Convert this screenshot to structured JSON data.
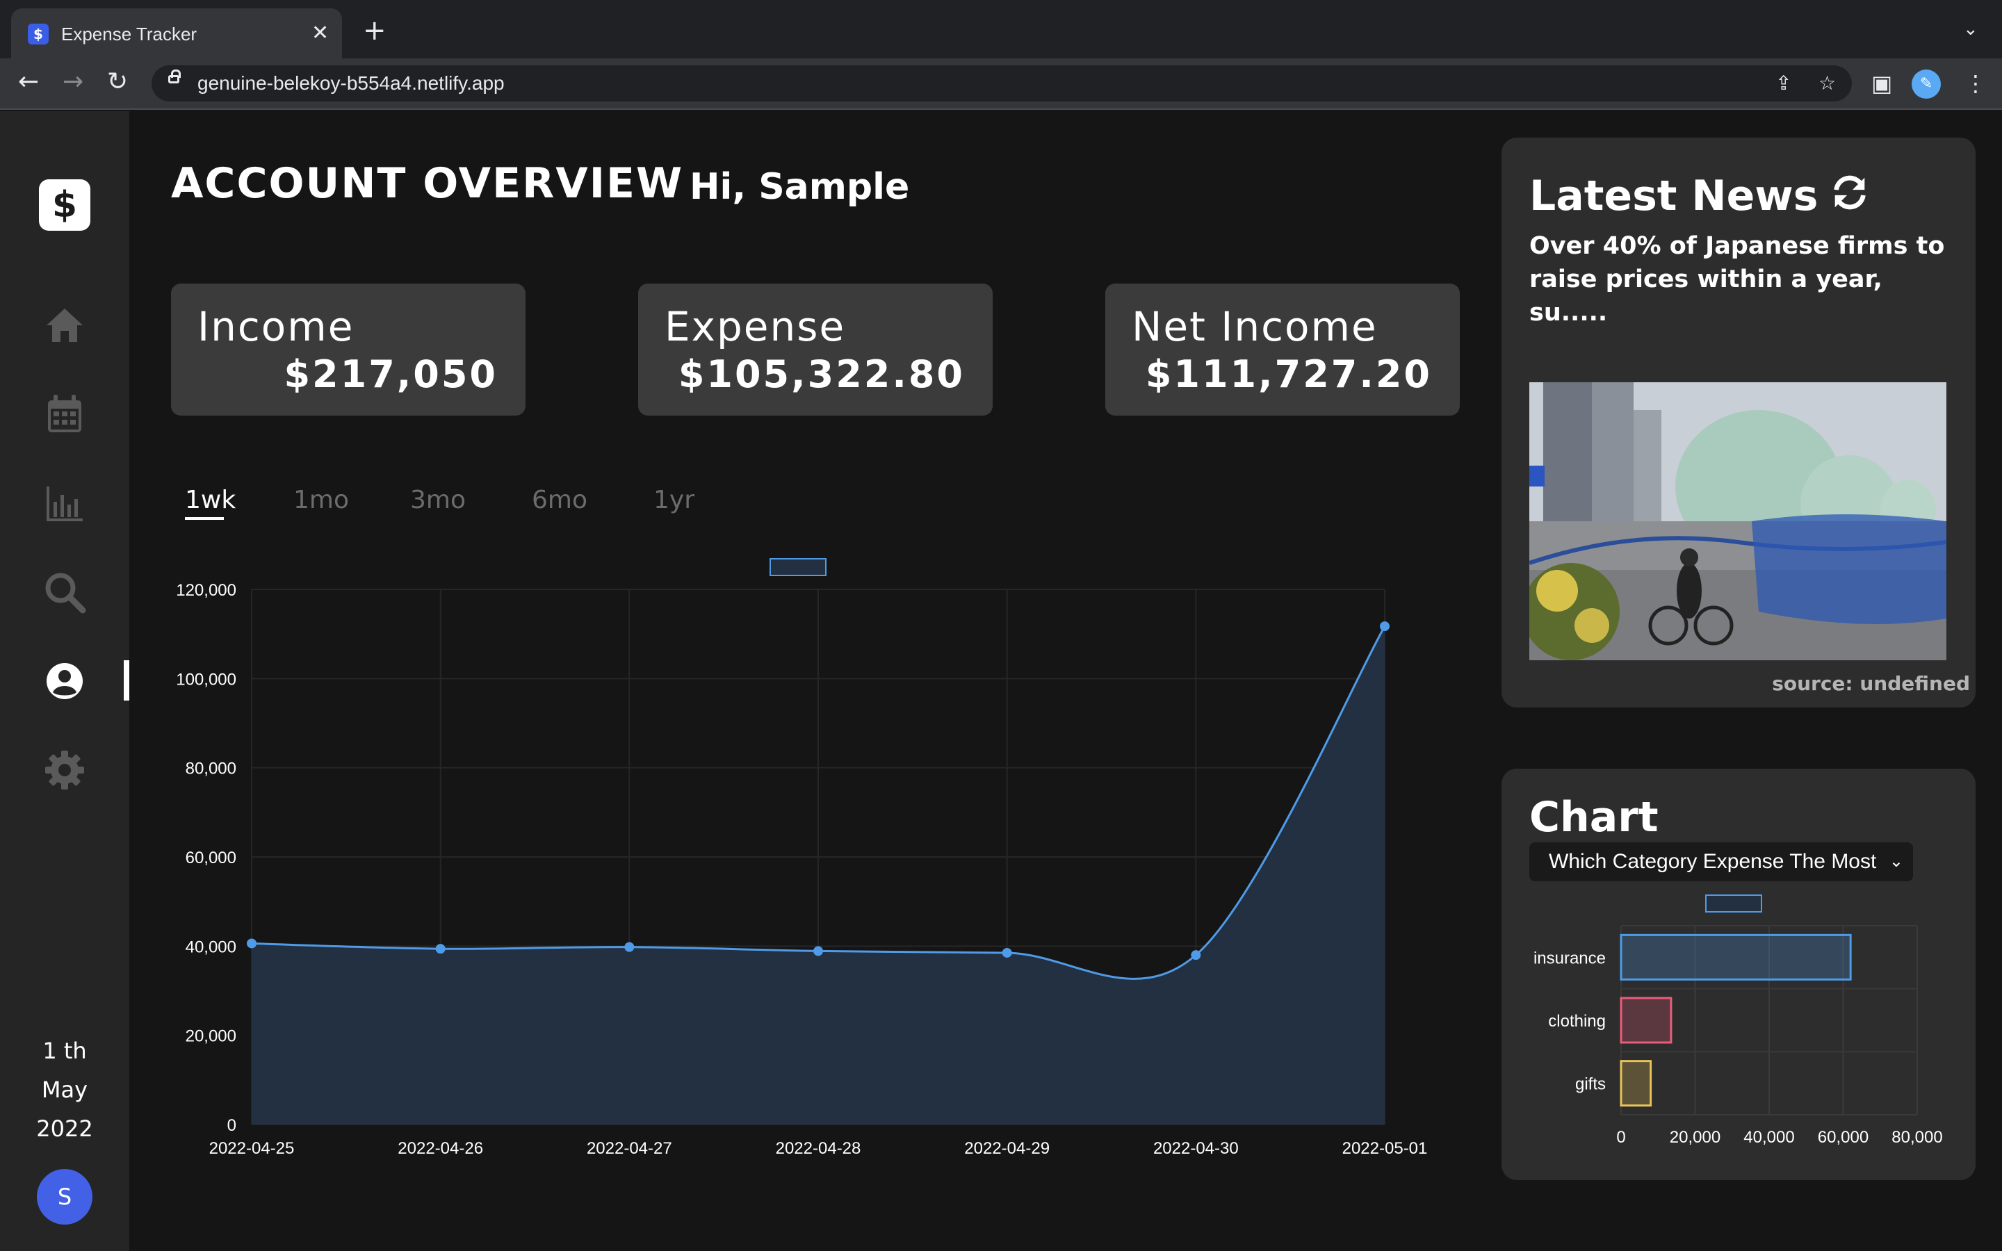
{
  "browser": {
    "tab_title": "Expense Tracker",
    "favicon": "$",
    "close_glyph": "✕",
    "new_tab_glyph": "+",
    "url": "genuine-belekoy-b554a4.netlify.app",
    "profile_initial": "✎"
  },
  "sidebar": {
    "logo": "$",
    "items": [
      {
        "name": "home-icon"
      },
      {
        "name": "calendar-icon"
      },
      {
        "name": "bar-chart-icon"
      },
      {
        "name": "search-icon"
      },
      {
        "name": "account-icon",
        "active": true
      },
      {
        "name": "settings-icon"
      }
    ],
    "date": {
      "day": "1 th",
      "month": "May",
      "year": "2022"
    },
    "avatar_initial": "S"
  },
  "header": {
    "title": "ACCOUNT OVERVIEW",
    "greeting": "Hi, Sample"
  },
  "stats": [
    {
      "label": "Income",
      "value": "$217,050"
    },
    {
      "label": "Expense",
      "value": "$105,322.80"
    },
    {
      "label": "Net Income",
      "value": "$111,727.20"
    }
  ],
  "range_tabs": [
    "1wk",
    "1mo",
    "3mo",
    "6mo",
    "1yr"
  ],
  "active_range": "1wk",
  "colors": {
    "line": "#4f9be8",
    "fill": "#233041",
    "bar_insurance": "#4f9be8",
    "bar_clothing": "#e85d7a",
    "bar_gifts": "#e8c35a"
  },
  "news": {
    "title": "Latest News",
    "headline": "Over 40% of Japanese firms to raise prices within a year, su.....",
    "source": "source: undefined"
  },
  "category_chart": {
    "title": "Chart",
    "select_value": "Which Category Expense The Most"
  },
  "chart_data": [
    {
      "type": "area",
      "x": [
        "2022-04-25",
        "2022-04-26",
        "2022-04-27",
        "2022-04-28",
        "2022-04-29",
        "2022-04-30",
        "2022-05-01"
      ],
      "series": [
        {
          "values": [
            40600,
            39400,
            39800,
            38900,
            38500,
            38000,
            111727.2
          ]
        }
      ],
      "ylim": [
        0,
        120000
      ],
      "yticks": [
        "0",
        "20,000",
        "40,000",
        "60,000",
        "80,000",
        "100,000",
        "120,000"
      ],
      "grid": true
    },
    {
      "type": "bar",
      "orientation": "horizontal",
      "categories": [
        "insurance",
        "clothing",
        "gifts"
      ],
      "values": [
        62000,
        13500,
        8000
      ],
      "xlim": [
        0,
        80000
      ],
      "xticks": [
        "0",
        "20,000",
        "40,000",
        "60,000",
        "80,000"
      ],
      "grid": true
    }
  ]
}
